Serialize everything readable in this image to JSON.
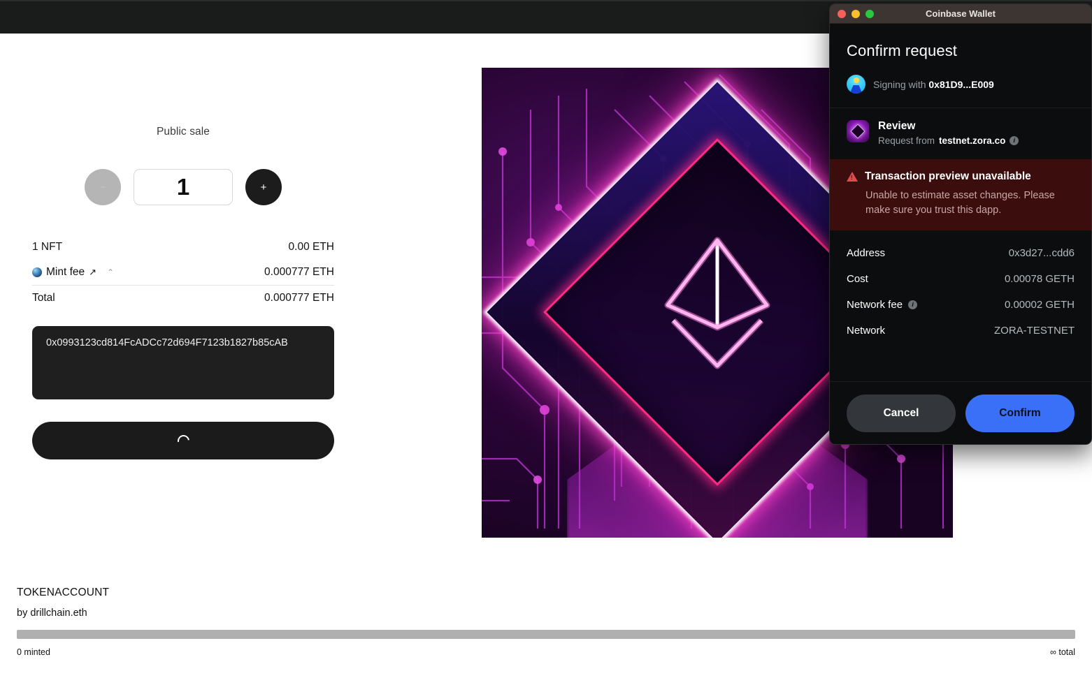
{
  "topbar": {
    "present": true
  },
  "mint": {
    "sale_label": "Public sale",
    "minus_label": "−",
    "plus_label": "+",
    "quantity": "1",
    "rows": [
      {
        "label": "1 NFT",
        "value": "0.00 ETH",
        "icon": ""
      },
      {
        "label": "Mint fee",
        "value": "0.000777 ETH",
        "icon": "globe-icon"
      },
      {
        "label": "Total",
        "value": "0.000777 ETH",
        "icon": ""
      }
    ],
    "row_nft_label": "1 NFT",
    "row_nft_value": "0.00 ETH",
    "row_fee_label": "Mint fee",
    "row_fee_value": "0.000777 ETH",
    "row_fee_external_link": "↗",
    "row_fee_caret": "⌃",
    "row_total_label": "Total",
    "row_total_value": "0.000777 ETH",
    "recipient_address": "0x0993123cd814FcADCc72d694F7123b1827b85cAB",
    "cta_state": "loading"
  },
  "artwork": {
    "alt": "Neon Ethereum diamond over circuit board"
  },
  "collection": {
    "title": "TOKENACCOUNT",
    "creator": "by drillchain.eth",
    "minted": "0 minted",
    "total": "∞ total",
    "progress_percent": 0
  },
  "wallet": {
    "window_title": "Coinbase Wallet",
    "heading": "Confirm request",
    "signing_prefix": "Signing with ",
    "signing_address": "0x81D9...E009",
    "review_title": "Review",
    "review_request_prefix": "Request from ",
    "review_domain": "testnet.zora.co",
    "info_glyph": "i",
    "warning": {
      "title": "Transaction preview unavailable",
      "body": "Unable to estimate asset changes. Please make sure you trust this dapp."
    },
    "details": [
      {
        "key": "Address",
        "value": "0x3d27...cdd6",
        "info": false
      },
      {
        "key": "Cost",
        "value": "0.00078 GETH",
        "info": false
      },
      {
        "key": "Network fee",
        "value": "0.00002 GETH",
        "info": true
      },
      {
        "key": "Network",
        "value": "ZORA-TESTNET",
        "info": false
      }
    ],
    "cancel_label": "Cancel",
    "confirm_label": "Confirm",
    "colors": {
      "confirm_blue": "#3a70f7",
      "warning_bg": "#3b0d0d",
      "warning_red": "#e04b4b",
      "window_bg": "#0b0d0e",
      "titlebar": "#3d3532"
    }
  }
}
